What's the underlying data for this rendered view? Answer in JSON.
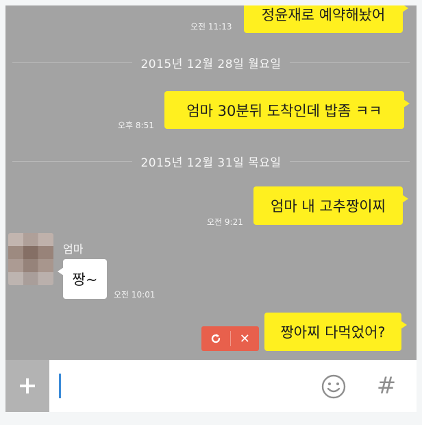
{
  "messages": [
    {
      "type": "outgoing",
      "text": "정윤재로 예약해놨어",
      "time": "오전 11:13"
    },
    {
      "type": "date",
      "text": "2015년 12월 28일 월요일"
    },
    {
      "type": "outgoing",
      "text": "엄마 30분뒤 도착인데 밥좀 ㅋㅋ",
      "time": "오후 8:51"
    },
    {
      "type": "date",
      "text": "2015년 12월 31일 목요일"
    },
    {
      "type": "outgoing",
      "text": "엄마 내 고추짱이찌",
      "time": "오전 9:21"
    },
    {
      "type": "incoming",
      "sender": "엄마",
      "text": "짱~",
      "time": "오전 10:01"
    },
    {
      "type": "outgoing-failed",
      "text": "짱아찌 다먹었어?",
      "time": ""
    }
  ],
  "failed_actions": {
    "retry_icon": "retry-icon",
    "cancel_icon": "cancel-icon",
    "cancel_glyph": "✕"
  },
  "input_bar": {
    "plus_icon": "plus-icon",
    "emoji_icon": "emoji-icon",
    "hash_label": "#",
    "value": "",
    "placeholder": ""
  },
  "colors": {
    "chat_bg": "#a3a3a3",
    "outgoing_bubble": "#fff01f",
    "incoming_bubble": "#ffffff",
    "failed": "#e8604c",
    "cursor": "#3b8bd8"
  }
}
